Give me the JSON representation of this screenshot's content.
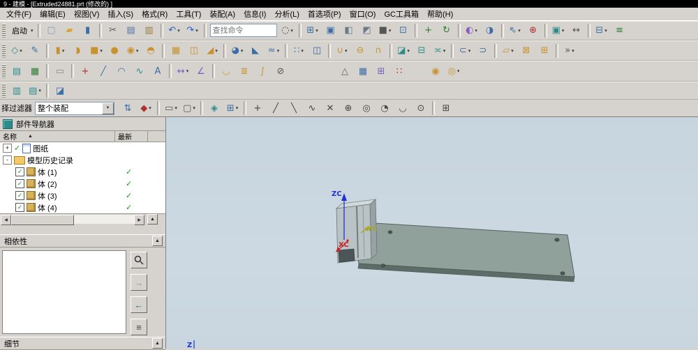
{
  "window": {
    "title": "9 - 建模 - [Extruded24881.prt (修改的) ]"
  },
  "menu": [
    {
      "id": "file",
      "label": "文件(F)"
    },
    {
      "id": "edit",
      "label": "编辑(E)"
    },
    {
      "id": "view",
      "label": "视图(V)"
    },
    {
      "id": "insert",
      "label": "插入(S)"
    },
    {
      "id": "format",
      "label": "格式(R)"
    },
    {
      "id": "tools",
      "label": "工具(T)"
    },
    {
      "id": "assemblies",
      "label": "装配(A)"
    },
    {
      "id": "information",
      "label": "信息(I)"
    },
    {
      "id": "analysis",
      "label": "分析(L)"
    },
    {
      "id": "preferences",
      "label": "首选项(P)"
    },
    {
      "id": "window",
      "label": "窗口(O)"
    },
    {
      "id": "gc-toolbox",
      "label": "GC工具箱"
    },
    {
      "id": "help",
      "label": "帮助(H)"
    }
  ],
  "search": {
    "placeholder": "查找命令"
  },
  "glyphs": {
    "collapse": "▲",
    "scroll_left": "◀",
    "scroll_right": "▶",
    "caret": "▾",
    "combo": "▼",
    "dep_back": "←",
    "dep_forward": "→",
    "dep_list": "≡"
  },
  "toolbar1": [
    {
      "grip": 1
    },
    {
      "n": "start-button",
      "type": "text",
      "label": "启动",
      "d": 1
    },
    {
      "sep": 1
    },
    {
      "n": "new-file-icon",
      "g": "▢",
      "c": "#7f9bbf"
    },
    {
      "n": "open-icon",
      "g": "▰",
      "c": "#d8a63c"
    },
    {
      "n": "save-icon",
      "g": "▮",
      "c": "#3a6ea5"
    },
    {
      "sep": 1
    },
    {
      "n": "cut-icon",
      "g": "✂",
      "c": "#5a5a5a"
    },
    {
      "n": "copy-icon",
      "g": "▤",
      "c": "#4a76a8"
    },
    {
      "n": "paste-icon",
      "g": "▥",
      "c": "#9a7a3a"
    },
    {
      "sep": 1
    },
    {
      "n": "undo-icon",
      "g": "↶",
      "c": "#2b5fc7",
      "d": 1
    },
    {
      "n": "redo-icon",
      "g": "↷",
      "c": "#2b5fc7",
      "d": 1
    },
    {
      "sep": 1
    },
    {
      "type": "search"
    },
    {
      "n": "search-icon",
      "g": "◌",
      "c": "#333333",
      "d": 1
    },
    {
      "sep": 1
    },
    {
      "n": "view-layout-icon",
      "g": "⊞",
      "c": "#3a6ea5",
      "d": 1
    },
    {
      "n": "maximize-view-icon",
      "g": "▣",
      "c": "#3a6ea5"
    },
    {
      "n": "wireframe-view-icon",
      "g": "◧",
      "c": "#6b7b8a"
    },
    {
      "n": "shaded-view-icon",
      "g": "◩",
      "c": "#6b7b8a"
    },
    {
      "n": "render-style-icon",
      "g": "■",
      "c": "#555555",
      "d": 1
    },
    {
      "n": "fit-view-icon",
      "g": "⊡",
      "c": "#3a6ea5"
    },
    {
      "sep": 1
    },
    {
      "n": "pan-view-icon",
      "g": "+",
      "c": "#2e7d32"
    },
    {
      "n": "rotate-view-icon",
      "g": "↻",
      "c": "#2e7d32"
    },
    {
      "sep": 1
    },
    {
      "n": "show-hide-icon",
      "g": "◐",
      "c": "#8a5cc0",
      "d": 1
    },
    {
      "n": "object-display-icon",
      "g": "◑",
      "c": "#3a6ea5"
    },
    {
      "sep": 1
    },
    {
      "n": "move-component-icon",
      "g": "⇖",
      "c": "#3a6ea5",
      "d": 1
    },
    {
      "n": "assembly-constraints-icon",
      "g": "⊕",
      "c": "#b03030"
    },
    {
      "sep": 1
    },
    {
      "n": "wave-link-icon",
      "g": "▣",
      "c": "#2e8b8b",
      "d": 1
    },
    {
      "n": "interpart-link-icon",
      "g": "↔",
      "c": "#555555"
    },
    {
      "sep": 1
    },
    {
      "n": "arrangements-icon",
      "g": "⊟",
      "c": "#3a6ea5",
      "d": 1
    },
    {
      "n": "sequence-icon",
      "g": "≡",
      "c": "#2e7d32"
    }
  ],
  "toolbar2": [
    {
      "grip": 1
    },
    {
      "n": "datum-plane-icon",
      "g": "◇",
      "c": "#2e8b8b",
      "d": 1
    },
    {
      "n": "sketch-icon",
      "g": "✎",
      "c": "#3a6ea5"
    },
    {
      "sep": 1
    },
    {
      "n": "extrude-icon",
      "g": "▮",
      "c": "#c8922e",
      "d": 1
    },
    {
      "n": "revolve-icon",
      "g": "◗",
      "c": "#c8922e"
    },
    {
      "n": "block-icon",
      "g": "■",
      "c": "#c8922e",
      "d": 1
    },
    {
      "n": "cylinder-icon",
      "g": "●",
      "c": "#c8922e"
    },
    {
      "n": "hole-icon",
      "g": "◉",
      "c": "#c8922e",
      "d": 1
    },
    {
      "n": "boss-icon",
      "g": "◓",
      "c": "#c8922e"
    },
    {
      "sep": 1
    },
    {
      "n": "rib-icon",
      "g": "▦",
      "c": "#c8922e"
    },
    {
      "n": "shell-icon",
      "g": "◫",
      "c": "#c8922e"
    },
    {
      "n": "draft-icon",
      "g": "◢",
      "c": "#c8922e",
      "d": 1
    },
    {
      "sep": 1
    },
    {
      "n": "edge-blend-icon",
      "g": "◕",
      "c": "#3a6ea5",
      "d": 1
    },
    {
      "n": "chamfer-icon",
      "g": "◣",
      "c": "#3a6ea5"
    },
    {
      "n": "thread-icon",
      "g": "≈",
      "c": "#3a6ea5",
      "d": 1
    },
    {
      "sep": 1
    },
    {
      "n": "pattern-feature-icon",
      "g": "∷",
      "c": "#3a6ea5",
      "d": 1
    },
    {
      "n": "mirror-feature-icon",
      "g": "◫",
      "c": "#3a6ea5"
    },
    {
      "sep": 1
    },
    {
      "n": "unite-icon",
      "g": "∪",
      "c": "#c8922e",
      "d": 1
    },
    {
      "n": "subtract-icon",
      "g": "⊖",
      "c": "#c8922e"
    },
    {
      "n": "intersect-icon",
      "g": "∩",
      "c": "#c8922e"
    },
    {
      "sep": 1
    },
    {
      "n": "trim-body-icon",
      "g": "◪",
      "c": "#2e8b8b",
      "d": 1
    },
    {
      "n": "split-body-icon",
      "g": "⊟",
      "c": "#2e8b8b"
    },
    {
      "n": "sew-icon",
      "g": "≍",
      "c": "#2e8b8b",
      "d": 1
    },
    {
      "sep": 1
    },
    {
      "n": "offset-surface-icon",
      "g": "⊂",
      "c": "#3a6ea5",
      "d": 1
    },
    {
      "n": "thicken-icon",
      "g": "⊃",
      "c": "#3a6ea5"
    },
    {
      "sep": 1
    },
    {
      "n": "move-face-icon",
      "g": "▱",
      "c": "#c8922e",
      "d": 1
    },
    {
      "n": "delete-face-icon",
      "g": "⊠",
      "c": "#c8922e"
    },
    {
      "n": "replace-face-icon",
      "g": "⊞",
      "c": "#c8922e"
    },
    {
      "sep": 1
    },
    {
      "n": "more-features-icon",
      "g": "»",
      "c": "#555555",
      "d": 1
    }
  ],
  "toolbar3": [
    {
      "grip": 1
    },
    {
      "n": "expressions-icon",
      "g": "▤",
      "c": "#2e8b8b"
    },
    {
      "n": "spreadsheet-icon",
      "g": "▦",
      "c": "#2e7d32"
    },
    {
      "sep": 1
    },
    {
      "n": "notes-icon",
      "g": "▭",
      "c": "#8a8a8a"
    },
    {
      "sep": 1
    },
    {
      "n": "point-icon",
      "g": "+",
      "c": "#b03030"
    },
    {
      "n": "line-icon",
      "g": "╱",
      "c": "#3a6ea5"
    },
    {
      "n": "arc-icon",
      "g": "◠",
      "c": "#3a6ea5"
    },
    {
      "n": "studio-spline-icon",
      "g": "∿",
      "c": "#2e8b8b"
    },
    {
      "n": "text-icon",
      "g": "A",
      "c": "#3a6ea5"
    },
    {
      "sep": 1
    },
    {
      "n": "measure-distance-icon",
      "g": "↔",
      "c": "#7a5cc0",
      "d": 1
    },
    {
      "n": "measure-angle-icon",
      "g": "∠",
      "c": "#7a5cc0"
    },
    {
      "sep": 1
    },
    {
      "n": "ruled-surface-icon",
      "g": "◡",
      "c": "#c8922e"
    },
    {
      "n": "through-curves-icon",
      "g": "≣",
      "c": "#c8922e"
    },
    {
      "n": "swept-icon",
      "g": "∫",
      "c": "#c8922e"
    },
    {
      "n": "deviation-gauge-icon",
      "g": "⊘",
      "c": "#555555"
    },
    {
      "gap": 66
    },
    {
      "n": "datum-csys-icon",
      "g": "△",
      "c": "#666666"
    },
    {
      "n": "work-plane-grid-icon",
      "g": "▦",
      "c": "#3a6ea5"
    },
    {
      "n": "view-section-icon",
      "g": "⊞",
      "c": "#7a5cc0"
    },
    {
      "n": "point-set-icon",
      "g": "∷",
      "c": "#b03030"
    },
    {
      "gap": 26
    },
    {
      "n": "user-defined-feature-icon",
      "g": "◉",
      "c": "#c8922e"
    },
    {
      "n": "reuse-library-icon",
      "g": "◎",
      "c": "#c8922e",
      "d": 1
    }
  ],
  "toolbar4": [
    {
      "grip": 1
    },
    {
      "n": "part-families-icon",
      "g": "▥",
      "c": "#2e8b8b"
    },
    {
      "n": "bom-table-icon",
      "g": "▤",
      "c": "#2e8b8b",
      "d": 1
    },
    {
      "sep": 1
    },
    {
      "n": "visual-report-icon",
      "g": "◪",
      "c": "#3a6ea5"
    }
  ],
  "selection_bar": {
    "filter_label": "择过滤器",
    "scope": "整个装配",
    "icons": [
      {
        "n": "selection-priority-icon",
        "g": "⇅",
        "c": "#3a6ea5"
      },
      {
        "n": "selection-rule-icon",
        "g": "◆",
        "c": "#b03030",
        "d": 1
      },
      {
        "sep": 1
      },
      {
        "n": "highlight-selection-icon",
        "g": "▭",
        "c": "#555555",
        "d": 1
      },
      {
        "n": "lasso-icon",
        "g": "▢",
        "c": "#555555",
        "d": 1
      },
      {
        "sep": 1
      },
      {
        "n": "shaded-select-icon",
        "g": "◈",
        "c": "#2e8b8b"
      },
      {
        "n": "snap-scope-icon",
        "g": "⊞",
        "c": "#3a6ea5",
        "d": 1
      },
      {
        "sep": 1
      },
      {
        "n": "snap-point-icon",
        "g": "+",
        "c": "#444444"
      },
      {
        "n": "snap-endpoint-icon",
        "g": "╱",
        "c": "#444444"
      },
      {
        "n": "snap-midpoint-icon",
        "g": "╲",
        "c": "#444444"
      },
      {
        "n": "snap-curve-icon",
        "g": "∿",
        "c": "#444444"
      },
      {
        "n": "snap-intersection-icon",
        "g": "✕",
        "c": "#444444"
      },
      {
        "n": "snap-arc-center-icon",
        "g": "⊕",
        "c": "#444444"
      },
      {
        "n": "snap-circle-center-icon",
        "g": "◎",
        "c": "#444444"
      },
      {
        "n": "snap-quadrant-icon",
        "g": "◔",
        "c": "#444444"
      },
      {
        "n": "snap-tangent-icon",
        "g": "◡",
        "c": "#444444"
      },
      {
        "n": "snap-point-on-face-icon",
        "g": "⊙",
        "c": "#444444"
      },
      {
        "sep": 1
      },
      {
        "n": "grid-snap-icon",
        "g": "⊞",
        "c": "#444444"
      }
    ]
  },
  "navigator": {
    "title": "部件导航器",
    "col_name": "名称",
    "sort_arrow": "▲",
    "col_latest": "最新",
    "check_glyph": "✓",
    "rows": [
      {
        "label": "图纸",
        "expand": "+",
        "check": true,
        "icon": "sheet"
      },
      {
        "label": "模型历史记录",
        "expand": "-",
        "icon": "folder"
      },
      {
        "label": "体 (1)",
        "indent": 1,
        "checkbox": true,
        "icon": "body",
        "latest": true
      },
      {
        "label": "体 (2)",
        "indent": 1,
        "checkbox": true,
        "icon": "body",
        "latest": true
      },
      {
        "label": "体 (3)",
        "indent": 1,
        "checkbox": true,
        "icon": "body",
        "latest": true
      },
      {
        "label": "体 (4)",
        "indent": 1,
        "checkbox": true,
        "icon": "body",
        "latest": true
      }
    ]
  },
  "dependencies": {
    "title": "相依性"
  },
  "details": {
    "title": "细节"
  },
  "viewport": {
    "zc": "ZC",
    "yc": "YC",
    "xc": "XC",
    "wcs_z": "Z"
  }
}
